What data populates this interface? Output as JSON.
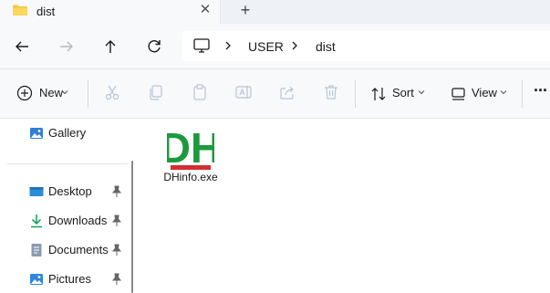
{
  "tab": {
    "title": "dist",
    "close_glyph": "✕",
    "add_glyph": "+"
  },
  "nav": {
    "back_icon": "arrow-left-icon",
    "forward_icon": "arrow-right-icon",
    "up_icon": "arrow-up-icon",
    "refresh_icon": "refresh-icon"
  },
  "breadcrumb": {
    "items": [
      "USER",
      "dist"
    ]
  },
  "commandbar": {
    "new_label": "New",
    "sort_label": "Sort",
    "view_label": "View",
    "more_glyph": "···"
  },
  "sidebar": {
    "items": [
      {
        "label": "Gallery",
        "icon": "gallery-icon",
        "pinned": false
      },
      {
        "label": "Desktop",
        "icon": "desktop-icon",
        "pinned": true
      },
      {
        "label": "Downloads",
        "icon": "download-icon",
        "pinned": true
      },
      {
        "label": "Documents",
        "icon": "documents-icon",
        "pinned": true
      },
      {
        "label": "Pictures",
        "icon": "pictures-icon",
        "pinned": true
      }
    ]
  },
  "files": [
    {
      "name": "DHinfo.exe",
      "icon": "dh-app-icon",
      "logo_text": "DH"
    }
  ],
  "colors": {
    "accent": "#0067c0",
    "folder": "#f4c542",
    "logo_green": "#1c9a3c",
    "logo_red": "#d32f2f"
  }
}
